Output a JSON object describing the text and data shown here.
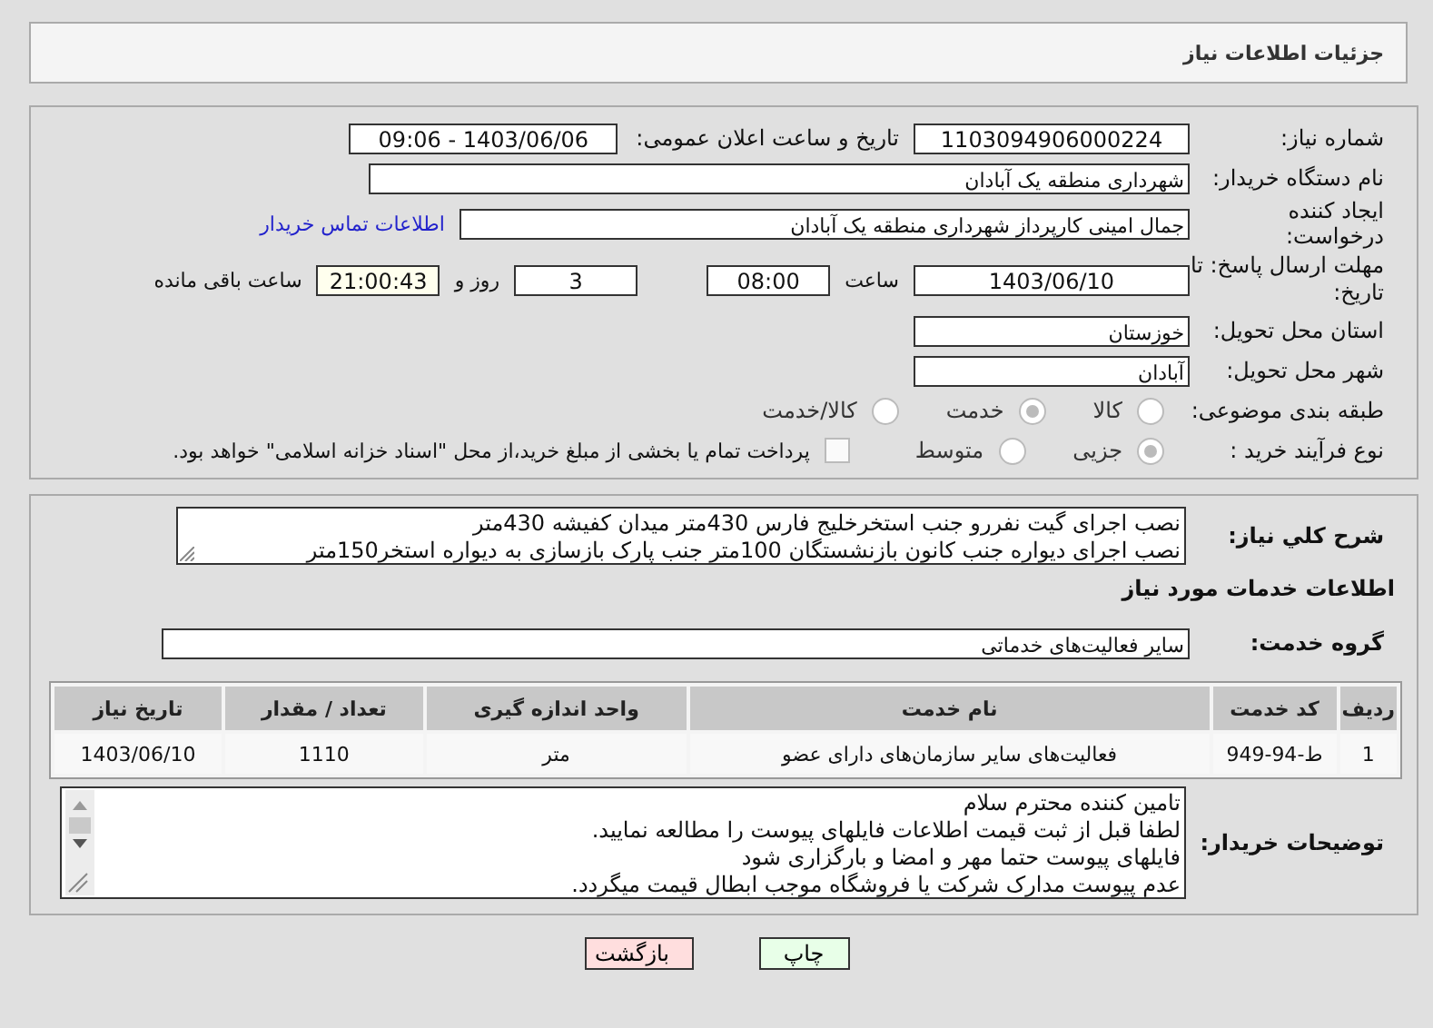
{
  "header": {
    "title": "جزئیات اطلاعات نیاز"
  },
  "fields": {
    "need_number": {
      "label": "شماره نیاز:",
      "value": "1103094906000224"
    },
    "announce": {
      "label": "تاریخ و ساعت اعلان عمومی:",
      "value": "1403/06/06 - 09:06"
    },
    "buyer": {
      "label": "نام دستگاه خریدار:",
      "value": "شهرداری منطقه یک آبادان"
    },
    "creator": {
      "label": "ایجاد کننده درخواست:",
      "value": "جمال امینی کارپرداز شهرداری منطقه یک آبادان",
      "link": "اطلاعات تماس خریدار"
    },
    "deadline": {
      "label": "مهلت ارسال پاسخ: تا تاریخ:",
      "date": "1403/06/10",
      "time_label": "ساعت",
      "time": "08:00",
      "days": "3",
      "days_label": "روز و",
      "remaining": "21:00:43",
      "remaining_label": "ساعت باقی مانده"
    },
    "province": {
      "label": "استان محل تحویل:",
      "value": "خوزستان"
    },
    "city": {
      "label": "شهر محل تحویل:",
      "value": "آبادان"
    }
  },
  "category": {
    "label": "طبقه بندی موضوعی:",
    "options": [
      {
        "label": "کالا",
        "selected": false
      },
      {
        "label": "خدمت",
        "selected": true
      },
      {
        "label": "کالا/خدمت",
        "selected": false
      }
    ]
  },
  "process": {
    "label": "نوع فرآیند خرید :",
    "options": [
      {
        "label": "جزیی",
        "selected": true
      },
      {
        "label": "متوسط",
        "selected": false
      }
    ],
    "treasury": {
      "checked": false,
      "text": "پرداخت تمام یا بخشی از مبلغ خرید،از محل \"اسناد خزانه اسلامی\" خواهد بود."
    }
  },
  "description": {
    "label": "شرح کلي نياز:",
    "lines": [
      "نصب اجرای گیت نفررو جنب استخرخلیج فارس 430متر میدان کفیشه 430متر",
      "نصب اجرای دیواره جنب کانون بازنشستگان 100متر جنب پارک بازسازی به دیواره استخر150متر"
    ]
  },
  "services_title": "اطلاعات خدمات مورد نياز",
  "service_group": {
    "label": "گروه خدمت:",
    "value": "سایر فعالیت‌های خدماتی"
  },
  "table": {
    "columns": [
      "ردیف",
      "کد خدمت",
      "نام خدمت",
      "واحد اندازه گیری",
      "تعداد / مقدار",
      "تاریخ نیاز"
    ],
    "rows": [
      [
        "1",
        "ط-94-949",
        "فعالیت‌های سایر سازمان‌های دارای عضو",
        "متر",
        "1110",
        "1403/06/10"
      ]
    ]
  },
  "notes": {
    "label": "توضیحات خریدار:",
    "lines": [
      "تامین کننده محترم سلام",
      "لطفا قبل از ثبت قیمت اطلاعات فایلهای پیوست را مطالعه نمایید.",
      "فایلهای پیوست حتما مهر و امضا و بارگزاری شود",
      "عدم پیوست مدارک شرکت یا فروشگاه موجب ابطال قیمت میگردد."
    ]
  },
  "buttons": [
    {
      "label": "چاپ",
      "kind": "print"
    },
    {
      "label": "بازگشت",
      "kind": "back"
    }
  ]
}
